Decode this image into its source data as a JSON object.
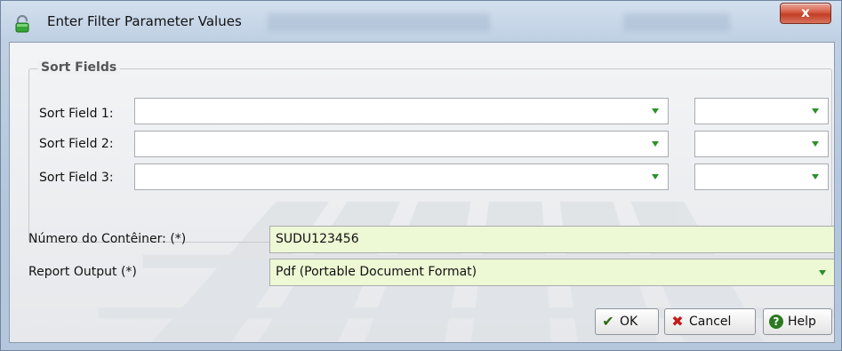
{
  "window": {
    "title": "Enter Filter Parameter Values",
    "close_label": "x"
  },
  "sort_group": {
    "legend": "Sort Fields",
    "fields": [
      {
        "label": "Sort Field 1:",
        "value": "",
        "direction": ""
      },
      {
        "label": "Sort Field 2:",
        "value": "",
        "direction": ""
      },
      {
        "label": "Sort Field 3:",
        "value": "",
        "direction": ""
      }
    ]
  },
  "params": {
    "container_label": "Número do Contêiner: (*)",
    "container_value": "SUDU123456",
    "output_label": "Report Output (*)",
    "output_value": "Pdf (Portable Document Format)"
  },
  "buttons": {
    "ok": "OK",
    "cancel": "Cancel",
    "help": "Help"
  },
  "colors": {
    "required_field_bg": "#edf8d4",
    "dropdown_arrow": "#2d8f2d",
    "close_button": "#c23d25"
  },
  "icons": {
    "title": "lock-icon",
    "ok": "checkmark-icon",
    "cancel": "x-icon",
    "help": "question-icon"
  }
}
